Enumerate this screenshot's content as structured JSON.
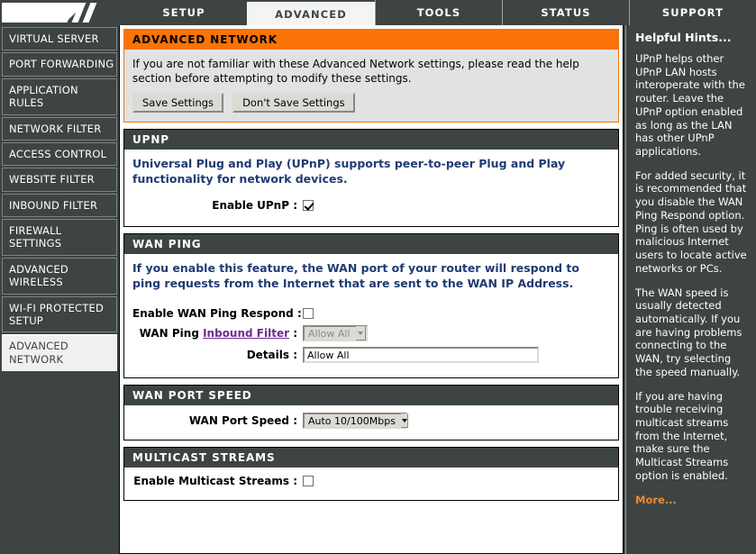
{
  "nav_tabs": [
    {
      "label": "SETUP",
      "active": false
    },
    {
      "label": "ADVANCED",
      "active": true
    },
    {
      "label": "TOOLS",
      "active": false
    },
    {
      "label": "STATUS",
      "active": false
    },
    {
      "label": "SUPPORT",
      "active": false
    }
  ],
  "sidebar": {
    "items": [
      {
        "label": "VIRTUAL SERVER"
      },
      {
        "label": "PORT FORWARDING"
      },
      {
        "label": "APPLICATION RULES"
      },
      {
        "label": "NETWORK FILTER"
      },
      {
        "label": "ACCESS CONTROL"
      },
      {
        "label": "WEBSITE FILTER"
      },
      {
        "label": "INBOUND FILTER"
      },
      {
        "label": "FIREWALL SETTINGS"
      },
      {
        "label": "ADVANCED WIRELESS"
      },
      {
        "label": "WI-FI PROTECTED SETUP"
      },
      {
        "label": "ADVANCED NETWORK"
      }
    ]
  },
  "intro": {
    "title": "ADVANCED NETWORK",
    "text": "If you are not familiar with these Advanced Network settings, please read the help section before attempting to modify these settings.",
    "save_label": "Save Settings",
    "dont_save_label": "Don't Save Settings"
  },
  "upnp": {
    "title": "UPNP",
    "description": "Universal Plug and Play (UPnP) supports peer-to-peer Plug and Play functionality for network devices.",
    "enable_label": "Enable UPnP :",
    "enable_checked": true
  },
  "wan_ping": {
    "title": "WAN PING",
    "description": "If you enable this feature, the WAN port of your router will respond to ping requests from the Internet that are sent to the WAN IP Address.",
    "respond_label": "Enable WAN Ping Respond :",
    "respond_checked": false,
    "filter_label_prefix": "WAN Ping ",
    "filter_link_text": "Inbound Filter",
    "filter_label_suffix": " :",
    "filter_value": "Allow All",
    "filter_disabled": true,
    "details_label": "Details :",
    "details_value": "Allow All"
  },
  "wan_port_speed": {
    "title": "WAN PORT SPEED",
    "speed_label": "WAN Port Speed :",
    "speed_value": "Auto 10/100Mbps"
  },
  "multicast": {
    "title": "MULTICAST STREAMS",
    "enable_label": "Enable Multicast Streams :",
    "enable_checked": false
  },
  "hints": {
    "title": "Helpful Hints...",
    "paragraphs": [
      "UPnP helps other UPnP LAN hosts interoperate with the router. Leave the UPnP option enabled as long as the LAN has other UPnP applications.",
      "For added security, it is recommended that you disable the WAN Ping Respond option. Ping is often used by malicious Internet users to locate active networks or PCs.",
      "The WAN speed is usually detected automatically. If you are having problems connecting to the WAN, try selecting the speed manually.",
      "If you are having trouble receiving multicast streams from the Internet, make sure the Multicast Streams option is enabled."
    ],
    "more_label": "More..."
  },
  "colors": {
    "accent_orange": "#f97306",
    "dark_bar": "#3e4444",
    "desc_blue": "#1f3b73",
    "link_purple": "#6b2d8f",
    "more_orange": "#f08a2a"
  }
}
